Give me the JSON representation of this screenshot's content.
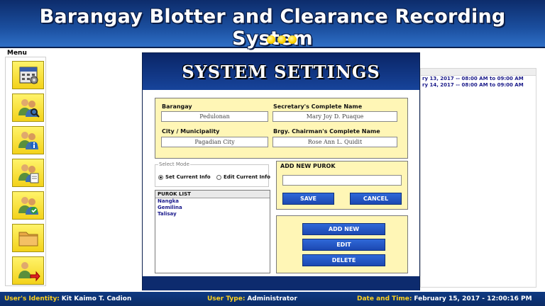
{
  "app": {
    "title": "Barangay Blotter and Clearance Recording System",
    "accent_color": "#1b4f9f",
    "highlight_color": "#fff6b6"
  },
  "menu": {
    "label": "Menu",
    "items": [
      {
        "icon": "calendar-settings-icon"
      },
      {
        "icon": "users-search-icon"
      },
      {
        "icon": "users-info-icon"
      },
      {
        "icon": "users-document-icon"
      },
      {
        "icon": "users-check-icon"
      },
      {
        "icon": "folder-icon"
      },
      {
        "icon": "user-logout-icon"
      }
    ]
  },
  "background_schedule": {
    "rows": [
      "ry 13, 2017 -- 08:00 AM  to  09:00 AM",
      "ry 14, 2017 -- 08:00 AM  to  09:00 AM"
    ]
  },
  "dialog": {
    "title": "SYSTEM SETTINGS",
    "fields": {
      "barangay": {
        "label": "Barangay",
        "value": "Pedulonan"
      },
      "secretary": {
        "label": "Secretary's Complete Name",
        "value": "Mary Joy D. Puaque"
      },
      "city": {
        "label": "City / Municipality",
        "value": "Pagadian City"
      },
      "chairman": {
        "label": "Brgy. Chairman's Complete Name",
        "value": "Rose Ann L. Quidit"
      }
    },
    "select_mode": {
      "legend": "Select Mode",
      "options": [
        "Set Current Info",
        "Edit Current Info"
      ],
      "selected": "Set Current Info"
    },
    "purok_list": {
      "header": "PUROK LIST",
      "items": [
        "Nangka",
        "Gemilina",
        "Talisay"
      ]
    },
    "add_purok": {
      "title": "ADD NEW PUROK",
      "value": "",
      "save_label": "SAVE",
      "cancel_label": "CANCEL"
    },
    "actions": {
      "add_new_label": "ADD NEW",
      "edit_label": "EDIT",
      "delete_label": "DELETE"
    }
  },
  "status_bar": {
    "identity_label": "User's Identity:",
    "identity_value": "Kit Kaimo T. Cadion",
    "type_label": "User Type:",
    "type_value": "Administrator",
    "datetime_label": "Date and Time:",
    "datetime_value": "February 15, 2017  -  12:00:16 PM"
  }
}
